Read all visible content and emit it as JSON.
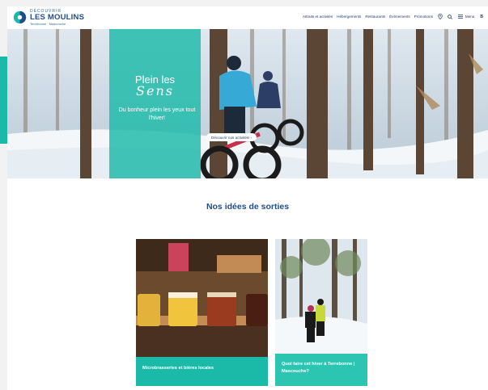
{
  "header": {
    "logo": {
      "top": "DÉCOUVRIR",
      "main": "LES MOULINS",
      "sub": "Terrebonne · Mascouche"
    },
    "nav": [
      "Attraits et activités",
      "Hébergements",
      "Restaurants",
      "Événements",
      "Promotions"
    ],
    "menu_label": "Menu",
    "extra": "B"
  },
  "hero": {
    "title": "Plein les",
    "script": "Sens",
    "subtitle": "Du bonheur plein les yeux tout l'hiver!",
    "cta": "Découvrir nos activités! ›"
  },
  "section": {
    "title": "Nos idées de sorties"
  },
  "cards": [
    {
      "label": "Microbrasseries et bières locales"
    },
    {
      "label": "Quoi faire cet hiver à Terrebonne | Mascouche?"
    }
  ],
  "colors": {
    "accent": "#1bb9a8",
    "brand": "#1e4d8c"
  }
}
